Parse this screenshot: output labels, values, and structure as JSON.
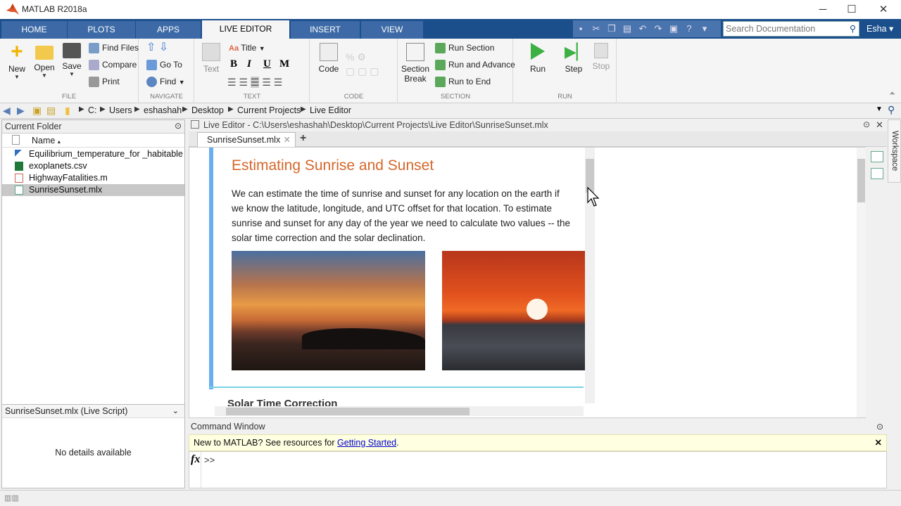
{
  "window": {
    "title": "MATLAB R2018a",
    "minimize": "─",
    "maximize": "☐",
    "close": "✕"
  },
  "tabs": [
    "HOME",
    "PLOTS",
    "APPS",
    "LIVE EDITOR",
    "INSERT",
    "VIEW"
  ],
  "active_tab": "LIVE EDITOR",
  "search": {
    "placeholder": "Search Documentation"
  },
  "user": {
    "name": "Esha"
  },
  "ribbon": {
    "file": {
      "label": "FILE",
      "new": "New",
      "open": "Open",
      "save": "Save",
      "find_files": "Find Files",
      "compare": "Compare",
      "print": "Print"
    },
    "navigate": {
      "label": "NAVIGATE",
      "go_to": "Go To",
      "find": "Find"
    },
    "text": {
      "label": "TEXT",
      "text": "Text",
      "style": "Title",
      "bold": "B",
      "italic": "I",
      "underline": "U",
      "mono": "M"
    },
    "code": {
      "label": "CODE",
      "code": "Code"
    },
    "section": {
      "label": "SECTION",
      "section_break_1": "Section",
      "section_break_2": "Break",
      "run_section": "Run Section",
      "run_advance": "Run and Advance",
      "run_end": "Run to End"
    },
    "run": {
      "label": "RUN",
      "run": "Run",
      "step": "Step",
      "stop": "Stop"
    }
  },
  "breadcrumb": [
    "C:",
    "Users",
    "eshashah",
    "Desktop",
    "Current Projects",
    "Live Editor"
  ],
  "current_folder": {
    "title": "Current Folder",
    "column": "Name",
    "sort_indicator": "▴",
    "files": [
      {
        "name": "Equilibrium_temperature_for _habitable p...",
        "type": "fig"
      },
      {
        "name": "exoplanets.csv",
        "type": "csv"
      },
      {
        "name": "HighwayFatalities.m",
        "type": "m"
      },
      {
        "name": "SunriseSunset.mlx",
        "type": "mlx",
        "selected": true
      }
    ]
  },
  "details": {
    "title": "SunriseSunset.mlx  (Live Script)",
    "empty": "No details available"
  },
  "editor": {
    "path": "Live Editor - C:\\Users\\eshashah\\Desktop\\Current Projects\\Live Editor\\SunriseSunset.mlx",
    "tab": "SunriseSunset.mlx",
    "add_tab": "+",
    "doc_title": "Estimating Sunrise and Sunset",
    "doc_paragraph": "We can estimate the time of sunrise and sunset for any location on the earth if we know the latitude, longitude, and UTC offset for that location.  To estimate sunrise and sunset for any day of the year we need to calculate two values -- the solar time correction and the solar declination.",
    "next_heading": "Solar Time Correction"
  },
  "workspace_label": "Workspace",
  "command_window": {
    "title": "Command Window",
    "banner_prefix": "New to MATLAB? See resources for ",
    "banner_link": "Getting Started",
    "banner_suffix": ".",
    "fx": "fx",
    "prompt": ">>"
  },
  "colors": {
    "accent": "#1b4f8c",
    "title_orange": "#d6672b",
    "section_bar": "#6aaef0"
  }
}
